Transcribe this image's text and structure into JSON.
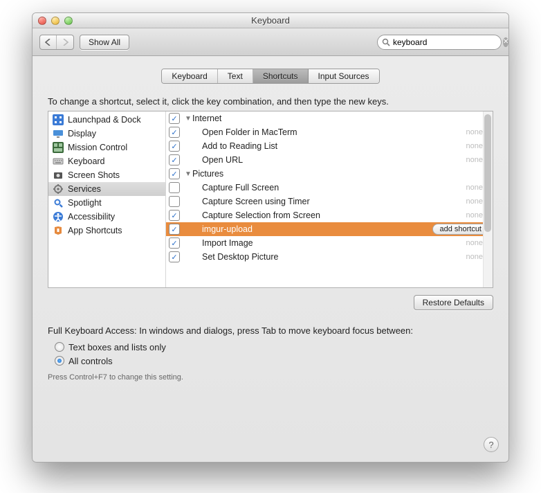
{
  "window": {
    "title": "Keyboard"
  },
  "toolbar": {
    "show_all": "Show All",
    "search_value": "keyboard"
  },
  "tabs": [
    "Keyboard",
    "Text",
    "Shortcuts",
    "Input Sources"
  ],
  "active_tab_index": 2,
  "instruction": "To change a shortcut, select it, click the key combination, and then type the new keys.",
  "categories": [
    {
      "label": "Launchpad & Dock",
      "icon": "launchpad"
    },
    {
      "label": "Display",
      "icon": "display"
    },
    {
      "label": "Mission Control",
      "icon": "mission"
    },
    {
      "label": "Keyboard",
      "icon": "keyboard"
    },
    {
      "label": "Screen Shots",
      "icon": "screenshot"
    },
    {
      "label": "Services",
      "icon": "services",
      "selected": true
    },
    {
      "label": "Spotlight",
      "icon": "spotlight"
    },
    {
      "label": "Accessibility",
      "icon": "accessibility"
    },
    {
      "label": "App Shortcuts",
      "icon": "appshortcuts"
    }
  ],
  "items": [
    {
      "type": "header",
      "label": "Internet",
      "checked": true
    },
    {
      "type": "item",
      "label": "Open Folder in MacTerm",
      "checked": true,
      "shortcut": "none"
    },
    {
      "type": "item",
      "label": "Add to Reading List",
      "checked": true,
      "shortcut": "none"
    },
    {
      "type": "item",
      "label": "Open URL",
      "checked": true,
      "shortcut": "none"
    },
    {
      "type": "header",
      "label": "Pictures",
      "checked": true
    },
    {
      "type": "item",
      "label": "Capture Full Screen",
      "checked": false,
      "shortcut": "none"
    },
    {
      "type": "item",
      "label": "Capture Screen using Timer",
      "checked": false,
      "shortcut": "none"
    },
    {
      "type": "item",
      "label": "Capture Selection from Screen",
      "checked": true,
      "shortcut": "none"
    },
    {
      "type": "item",
      "label": "imgur-upload",
      "checked": true,
      "shortcut": "add shortcut",
      "selected": true,
      "add_button": true
    },
    {
      "type": "item",
      "label": "Import Image",
      "checked": true,
      "shortcut": "none"
    },
    {
      "type": "item",
      "label": "Set Desktop Picture",
      "checked": true,
      "shortcut": "none"
    }
  ],
  "restore_defaults": "Restore Defaults",
  "fka": {
    "label": "Full Keyboard Access: In windows and dialogs, press Tab to move keyboard focus between:",
    "options": [
      "Text boxes and lists only",
      "All controls"
    ],
    "selected_index": 1,
    "hint": "Press Control+F7 to change this setting."
  }
}
